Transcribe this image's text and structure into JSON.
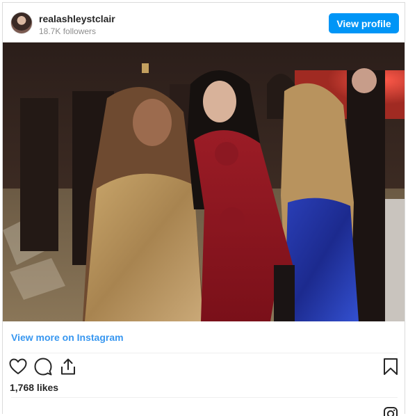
{
  "header": {
    "username": "realashleystclair",
    "followers": "18.7K followers",
    "view_profile_label": "View profile"
  },
  "post": {
    "view_more_label": "View more on Instagram",
    "likes": "1,768 likes"
  },
  "icons": {
    "like": "heart-icon",
    "comment": "comment-icon",
    "share": "share-icon",
    "save": "bookmark-icon",
    "footer": "instagram-logo-icon"
  },
  "colors": {
    "accent": "#0095f6",
    "link": "#3897f0",
    "text": "#262626",
    "muted": "#8e8e8e"
  }
}
